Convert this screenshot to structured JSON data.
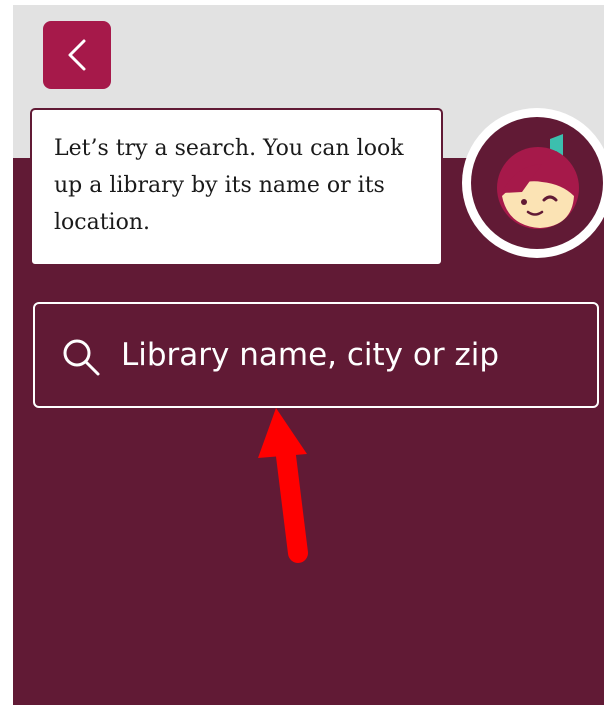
{
  "header": {
    "back_icon": "chevron-left-icon"
  },
  "tooltip": {
    "text": "Let’s try a search. You can look up a library by its name or its location."
  },
  "avatar": {
    "icon": "libby-mascot-avatar"
  },
  "search": {
    "icon": "search-icon",
    "placeholder": "Library name, city or zip"
  },
  "annotation": {
    "icon": "red-arrow-pointer",
    "color": "#ff0000"
  },
  "colors": {
    "background": "#611a35",
    "top_bar": "#e2e2e2",
    "back_button": "#a6194a"
  }
}
